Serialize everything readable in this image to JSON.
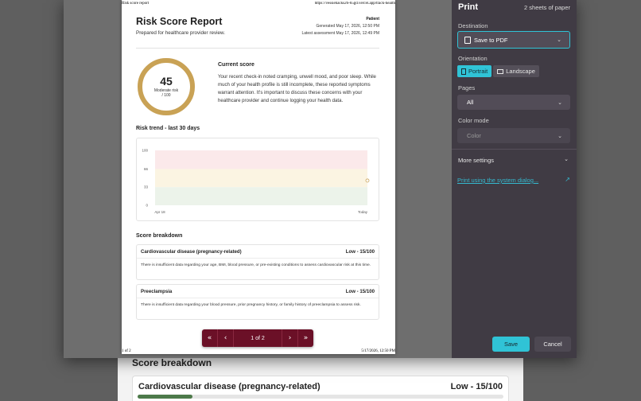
{
  "background": {
    "heading": "Score breakdown",
    "card_title": "Cardiovascular disease (pregnancy-related)",
    "card_score": "Low - 15/100",
    "card_fraction": 0.15
  },
  "paper": {
    "header_left": "Risk score report",
    "header_right": "https://vessiehacks26-65gd.vercel.app/track-health",
    "footer_left": "1 of 2",
    "footer_right": "5/17/2026, 12:50 PM",
    "title": "Risk Score Report",
    "subtitle": "Prepared for healthcare provider review.",
    "meta": {
      "patient": "Patient",
      "generated": "Generated May 17, 2026, 12:50 PM",
      "latest": "Latest assessment May 17, 2026, 12:49 PM"
    },
    "score": {
      "value": "45",
      "label_line1": "Moderate risk",
      "label_line2": "/ 100",
      "fraction": 0.45,
      "ring_color": "#c9a255"
    },
    "current_score": {
      "title": "Current score",
      "body": "Your recent check-in noted cramping, unwell mood, and poor sleep. While much of your health profile is still incomplete, these reported symptoms warrant attention. It's important to discuss these concerns with your healthcare provider and continue logging your health data."
    },
    "trend_title": "Risk trend - last 30 days",
    "breakdown_title": "Score breakdown",
    "breakdown": [
      {
        "name": "Cardiovascular disease (pregnancy-related)",
        "risk": "Low - 15/100",
        "desc": "There is insufficient data regarding your age, BMI, blood pressure, or pre-existing conditions to assess cardiovascular risk at this time."
      },
      {
        "name": "Preeclampsia",
        "risk": "Low - 15/100",
        "desc": "There is insufficient data regarding your blood pressure, prior pregnancy history, or family history of preeclampsia to assess risk."
      }
    ]
  },
  "chart_data": {
    "type": "scatter",
    "x_tick_labels": [
      "Apr 18",
      "Today"
    ],
    "y_ticks": [
      0,
      33,
      66,
      100
    ],
    "ylim": [
      0,
      100
    ],
    "bands": [
      {
        "from": 66,
        "to": 100,
        "color": "#fbe9ea"
      },
      {
        "from": 33,
        "to": 66,
        "color": "#fbf4e2"
      },
      {
        "from": 0,
        "to": 33,
        "color": "#ecf3ea"
      }
    ],
    "points": [
      {
        "x": "Today",
        "y": 45
      }
    ],
    "point_color": "#c9a255",
    "grid": false,
    "legend": "none"
  },
  "pager": {
    "first": "«",
    "prev": "‹",
    "count": "1 of 2",
    "next": "›",
    "last": "»"
  },
  "panel": {
    "title": "Print",
    "sheets": "2 sheets of paper",
    "destination_label": "Destination",
    "destination_value": "Save to PDF",
    "orientation_label": "Orientation",
    "portrait": "Portrait",
    "landscape": "Landscape",
    "pages_label": "Pages",
    "pages_value": "All",
    "color_label": "Color mode",
    "color_value": "Color",
    "more_settings": "More settings",
    "system_dialog": "Print using the system dialog...",
    "save": "Save",
    "cancel": "Cancel",
    "accent": "#30c3d6"
  }
}
